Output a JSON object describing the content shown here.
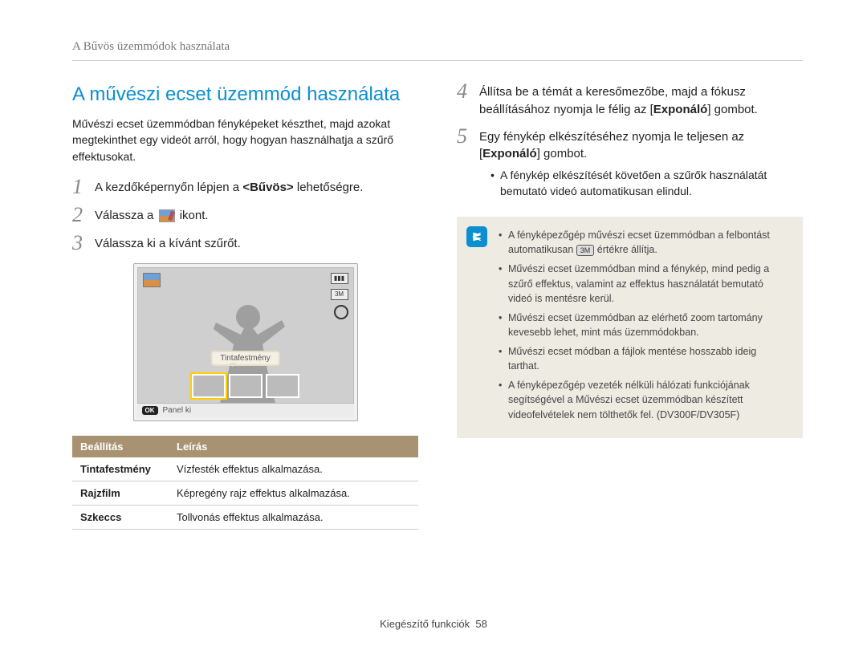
{
  "breadcrumb": "A Bűvös üzemmódok használata",
  "section_title": "A művészi ecset üzemmód használata",
  "intro": "Művészi ecset üzemmódban fényképeket készthet, majd azokat megtekinthet egy videót arról, hogy hogyan használhatja a szűrő effektusokat.",
  "steps_left": [
    {
      "num": "1",
      "pre": "A kezdőképernyőn lépjen a ",
      "bold": "<Bűvös>",
      "post": " lehetőségre."
    },
    {
      "num": "2",
      "pre": "Válassza a ",
      "icon": true,
      "post": " ikont."
    },
    {
      "num": "3",
      "pre": "Válassza ki a kívánt szűrőt.",
      "post": ""
    }
  ],
  "camera": {
    "thumb_label": "Tintafestmény",
    "ok_badge": "OK",
    "ok_text": "Panel ki",
    "res_badge": "3M"
  },
  "table": {
    "h1": "Beállítás",
    "h2": "Leírás",
    "rows": [
      {
        "k": "Tintafestmény",
        "v": "Vízfesték effektus alkalmazása."
      },
      {
        "k": "Rajzfilm",
        "v": "Képregény rajz effektus alkalmazása."
      },
      {
        "k": "Szkeccs",
        "v": "Tollvonás effektus alkalmazása."
      }
    ]
  },
  "steps_right": [
    {
      "num": "4",
      "text_pre": "Állítsa be a témát a keresőmezőbe, majd a fókusz beállításához nyomja le félig az [",
      "bold": "Exponáló",
      "text_post": "] gombot."
    },
    {
      "num": "5",
      "text_pre": "Egy fénykép elkészítéséhez nyomja le teljesen az [",
      "bold": "Exponáló",
      "text_post": "] gombot.",
      "bullets": [
        "A fénykép elkészítését követően a szűrők használatát bemutató videó automatikusan elindul."
      ]
    }
  ],
  "note": {
    "items": [
      {
        "pre": "A fényképezőgép művészi ecset üzemmódban a felbontást automatikusan ",
        "badge": "3M",
        "post": " értékre állítja."
      },
      {
        "text": "Művészi ecset üzemmódban mind a fénykép, mind pedig a szűrő effektus, valamint az effektus használatát bemutató videó is mentésre kerül."
      },
      {
        "text": "Művészi ecset üzemmódban az elérhető zoom tartomány kevesebb lehet, mint más üzemmódokban."
      },
      {
        "text": "Művészi ecset módban a fájlok mentése hosszabb ideig tarthat."
      },
      {
        "text": "A fényképezőgép vezeték nélküli hálózati funkciójának segítségével a Művészi ecset üzemmódban készített videofelvételek nem tölthetők fel. (DV300F/DV305F)"
      }
    ]
  },
  "footer": {
    "label": "Kiegészítő funkciók",
    "page": "58"
  }
}
